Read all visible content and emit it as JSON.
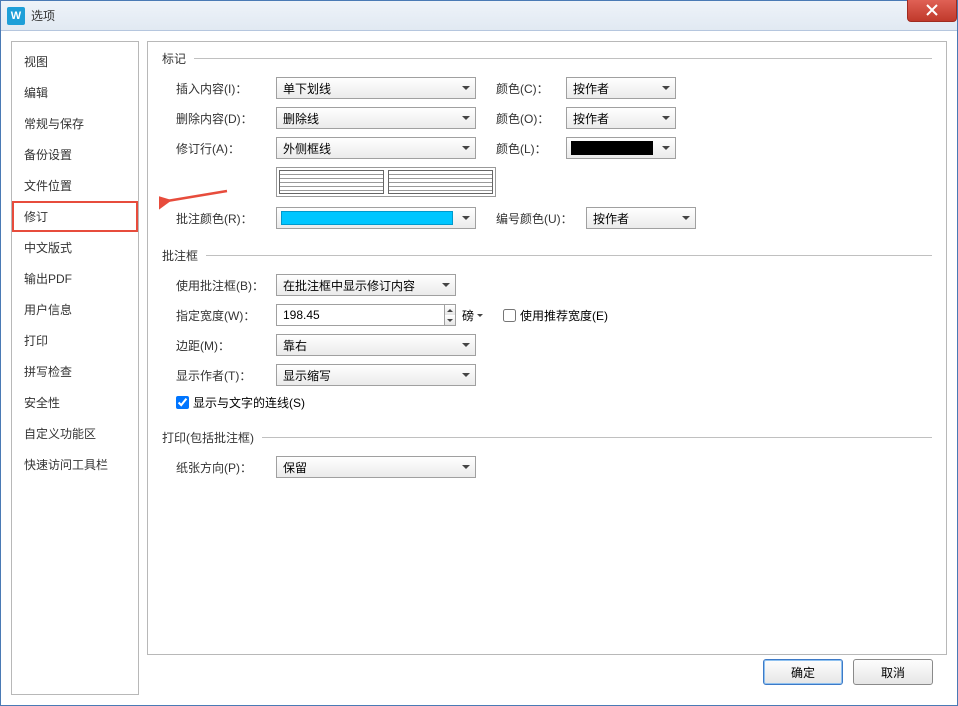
{
  "window": {
    "title": "选项",
    "app_icon_letter": "W"
  },
  "sidebar": {
    "items": [
      {
        "label": "视图"
      },
      {
        "label": "编辑"
      },
      {
        "label": "常规与保存"
      },
      {
        "label": "备份设置"
      },
      {
        "label": "文件位置"
      },
      {
        "label": "修订"
      },
      {
        "label": "中文版式"
      },
      {
        "label": "输出PDF"
      },
      {
        "label": "用户信息"
      },
      {
        "label": "打印"
      },
      {
        "label": "拼写检查"
      },
      {
        "label": "安全性"
      },
      {
        "label": "自定义功能区"
      },
      {
        "label": "快速访问工具栏"
      }
    ],
    "active_index": 5
  },
  "groups": {
    "marking": {
      "legend": "标记",
      "insert_label": "插入内容(I)：",
      "insert_value": "单下划线",
      "insert_color_label": "颜色(C)：",
      "insert_color_value": "按作者",
      "delete_label": "删除内容(D)：",
      "delete_value": "删除线",
      "delete_color_label": "颜色(O)：",
      "delete_color_value": "按作者",
      "revline_label": "修订行(A)：",
      "revline_value": "外侧框线",
      "revline_color_label": "颜色(L)：",
      "revline_color_swatch": "#000000",
      "comment_color_label": "批注颜色(R)：",
      "comment_color_swatch": "#00c6ff",
      "number_color_label": "编号颜色(U)：",
      "number_color_value": "按作者"
    },
    "balloon": {
      "legend": "批注框",
      "use_label": "使用批注框(B)：",
      "use_value": "在批注框中显示修订内容",
      "width_label": "指定宽度(W)：",
      "width_value": "198.45",
      "width_unit": "磅",
      "recommend_label": "使用推荐宽度(E)",
      "recommend_checked": false,
      "margin_label": "边距(M)：",
      "margin_value": "靠右",
      "author_label": "显示作者(T)：",
      "author_value": "显示缩写",
      "connector_label": "显示与文字的连线(S)",
      "connector_checked": true
    },
    "print": {
      "legend": "打印(包括批注框)",
      "orientation_label": "纸张方向(P)：",
      "orientation_value": "保留"
    }
  },
  "footer": {
    "ok": "确定",
    "cancel": "取消"
  }
}
